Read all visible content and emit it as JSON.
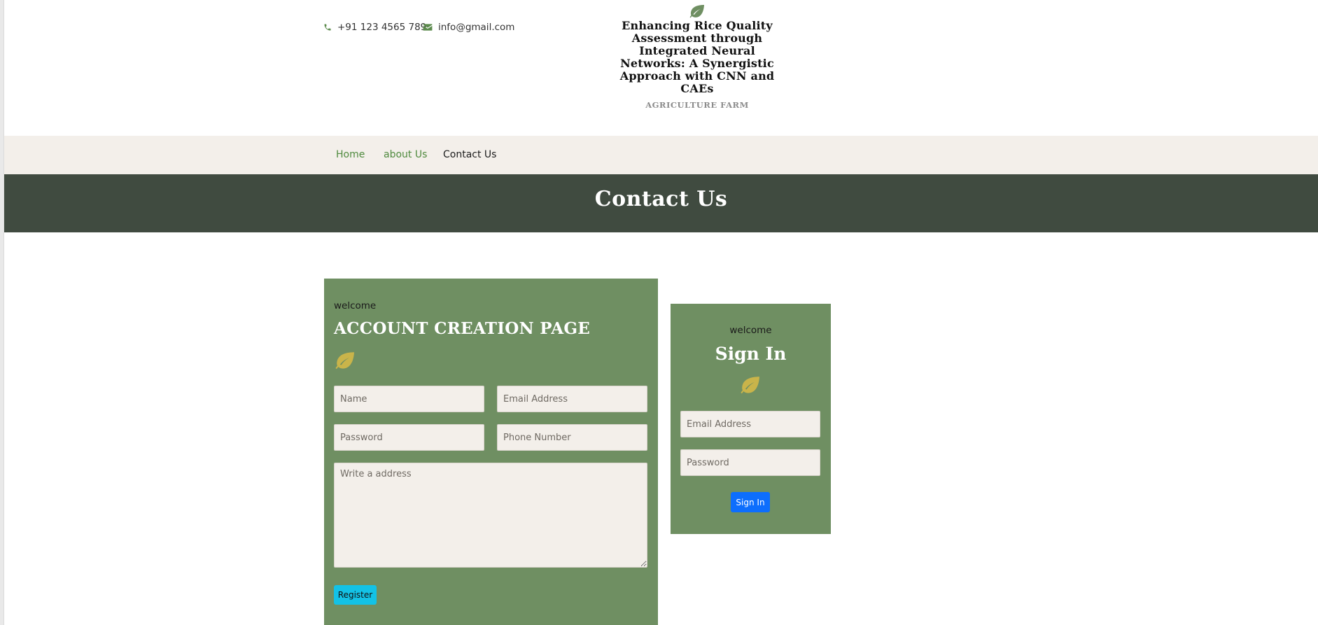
{
  "header": {
    "phone": "+91 123 4565 789",
    "email": "info@gmail.com",
    "brand_title": "Enhancing Rice Quality Assessment through Integrated Neural Networks: A Synergistic Approach with CNN and CAEs",
    "brand_subtitle": "AGRICULTURE FARM"
  },
  "nav": {
    "items": [
      {
        "label": "Home"
      },
      {
        "label": "about Us"
      },
      {
        "label": "Contact Us"
      }
    ]
  },
  "banner": {
    "title": "Contact Us"
  },
  "register": {
    "welcome": "welcome",
    "title": "ACCOUNT CREATION PAGE",
    "name_placeholder": "Name",
    "email_placeholder": "Email Address",
    "password_placeholder": "Password",
    "phone_placeholder": "Phone Number",
    "address_placeholder": "Write a address",
    "button_label": "Register"
  },
  "signin": {
    "welcome": "welcome",
    "title": "Sign In",
    "email_placeholder": "Email Address",
    "password_placeholder": "Password",
    "button_label": "Sign In"
  },
  "colors": {
    "accent_green": "#6f8f62",
    "banner_bg": "#404b40",
    "nav_bg": "#f3efea",
    "leaf_gold": "#c9b44a",
    "register_button": "#13c2e6",
    "signin_button": "#0d6efd"
  },
  "icons": [
    "phone-icon",
    "envelope-icon",
    "leaf-icon"
  ]
}
